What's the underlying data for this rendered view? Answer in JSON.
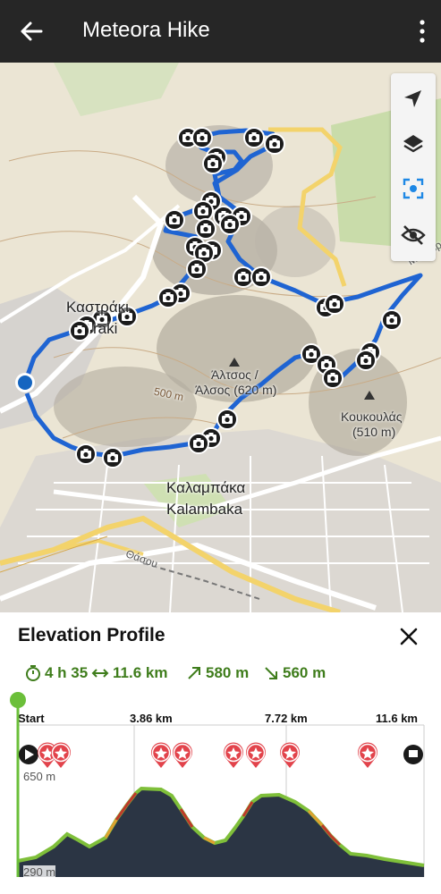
{
  "app": {
    "title": "Meteora Hike",
    "icons": {
      "back": "arrow-left-icon",
      "more": "more-vert-icon"
    }
  },
  "map": {
    "labels": {
      "kastraki_gr": "Καστράκι",
      "kastraki_en": "raki",
      "altsos_gr": "Άλτσος /",
      "altsos_sub": "Άλσος (620 m)",
      "koukoulas_gr": "Κουκουλάς",
      "koukoulas_elev": "(510 m)",
      "kalambaka_gr": "Καλαμπάκα",
      "kalambaka_en": "Kalambaka",
      "contour_500": "500 m",
      "road_thassou": "Θάσου",
      "road_meteora": "Μετεώρ"
    },
    "tools": [
      "navigation-arrow-icon",
      "layers-icon",
      "center-focus-icon",
      "visibility-off-icon"
    ],
    "colors": {
      "track": "#1565c0",
      "road_yellow": "#f3d36b",
      "forest": "#c5d9a5"
    }
  },
  "profile": {
    "title": "Elevation Profile",
    "stats": {
      "duration": "4 h 35",
      "distance": "11.6 km",
      "ascent": "580 m",
      "descent": "560 m"
    },
    "axis": [
      "Start",
      "3.86 km",
      "7.72 km",
      "11.6 km"
    ],
    "elev_max": "650 m",
    "elev_min": "290 m",
    "colors": {
      "stats": "#3f7d1c",
      "marker": "#e2434b",
      "fill": "#2b3544",
      "line": "#7fbf3a"
    }
  }
}
